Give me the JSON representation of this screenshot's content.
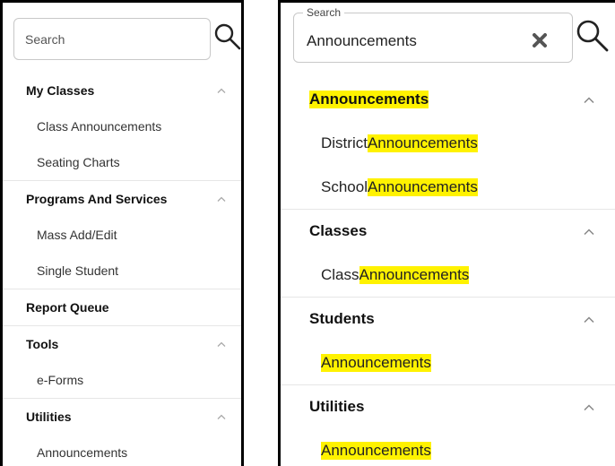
{
  "left": {
    "search": {
      "placeholder": "Search"
    },
    "sections": [
      {
        "title": "My Classes",
        "chevron": "chevron-up-icon",
        "items": [
          "Class Announcements",
          "Seating Charts"
        ]
      },
      {
        "title": "Programs And Services",
        "chevron": "chevron-up-icon",
        "items": [
          "Mass Add/Edit",
          "Single Student"
        ]
      },
      {
        "title": "Report Queue",
        "items": []
      },
      {
        "title": "Tools",
        "chevron": "chevron-up-icon",
        "items": [
          "e-Forms"
        ]
      },
      {
        "title": "Utilities",
        "chevron": "chevron-up-icon",
        "items": [
          "Announcements"
        ]
      }
    ]
  },
  "right": {
    "search": {
      "label": "Search",
      "value": "Announcements",
      "clear_icon": "close-icon"
    },
    "highlight_color": "#fff200",
    "sections": [
      {
        "title": "Announcements",
        "title_highlighted": true,
        "chevron": "chevron-up-icon",
        "items": [
          {
            "prefix": "District ",
            "match": "Announcements"
          },
          {
            "prefix": "School ",
            "match": "Announcements"
          }
        ]
      },
      {
        "title": "Classes",
        "chevron": "chevron-up-icon",
        "items": [
          {
            "prefix": "Class ",
            "match": "Announcements"
          }
        ]
      },
      {
        "title": "Students",
        "chevron": "chevron-up-icon",
        "items": [
          {
            "prefix": "",
            "match": "Announcements"
          }
        ]
      },
      {
        "title": "Utilities",
        "chevron": "chevron-up-icon",
        "items": [
          {
            "prefix": "",
            "match": "Announcements"
          }
        ]
      }
    ]
  }
}
